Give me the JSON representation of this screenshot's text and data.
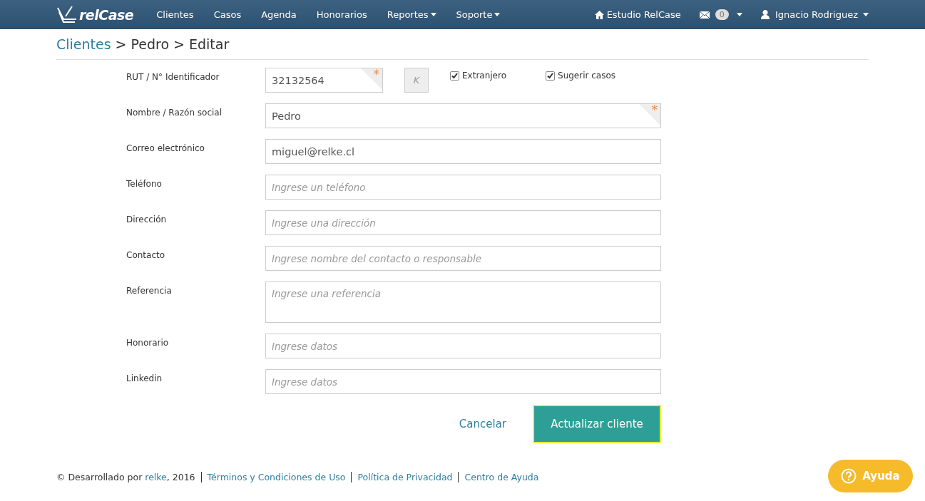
{
  "navbar": {
    "brand": "relCase",
    "items": [
      {
        "label": "Clientes",
        "dropdown": false
      },
      {
        "label": "Casos",
        "dropdown": false
      },
      {
        "label": "Agenda",
        "dropdown": false
      },
      {
        "label": "Honorarios",
        "dropdown": false
      },
      {
        "label": "Reportes",
        "dropdown": true
      },
      {
        "label": "Soporte",
        "dropdown": true
      }
    ],
    "office": "Estudio RelCase",
    "messages_count": "0",
    "user": "Ignacio Rodriguez"
  },
  "breadcrumb": [
    {
      "text": "Clientes",
      "kind": "link"
    },
    {
      "text": ">",
      "kind": "separator"
    },
    {
      "text": "Pedro",
      "kind": "text"
    },
    {
      "text": ">",
      "kind": "separator"
    },
    {
      "text": "Editar",
      "kind": "text"
    }
  ],
  "form": {
    "rut": {
      "label": "RUT / N° Identificador",
      "value": "32132564",
      "required": true,
      "check_digit_placeholder": "K",
      "options": [
        {
          "label": "Extranjero",
          "checked": true
        },
        {
          "label": "Sugerir casos",
          "checked": true
        }
      ]
    },
    "fields": [
      {
        "label": "Nombre / Razón social",
        "value": "Pedro",
        "required": true,
        "kind": "text"
      },
      {
        "label": "Correo electrónico",
        "value": "miguel@relke.cl",
        "required": false,
        "kind": "text"
      },
      {
        "label": "Teléfono",
        "placeholder": "Ingrese un teléfono",
        "required": false,
        "kind": "text"
      },
      {
        "label": "Dirección",
        "placeholder": "Ingrese una dirección",
        "required": false,
        "kind": "text"
      },
      {
        "label": "Contacto",
        "placeholder": "Ingrese nombre del contacto o responsable",
        "required": false,
        "kind": "text"
      },
      {
        "label": "Referencia",
        "placeholder": "Ingrese una referencia",
        "required": false,
        "kind": "textarea"
      },
      {
        "label": "Honorario",
        "placeholder": "Ingrese datos",
        "required": false,
        "kind": "text"
      },
      {
        "label": "Linkedin",
        "placeholder": "Ingrese datos",
        "required": false,
        "kind": "text"
      }
    ],
    "required_mark": "*",
    "cancel": "Cancelar",
    "submit": "Actualizar cliente"
  },
  "footer": {
    "credit_prefix": "© Desarrollado por",
    "credit_link": "relke",
    "credit_suffix": ", 2016",
    "links": [
      "Términos y Condiciones de Uso",
      "Política de Privacidad",
      "Centro de Ayuda"
    ]
  },
  "help_button": "Ayuda"
}
